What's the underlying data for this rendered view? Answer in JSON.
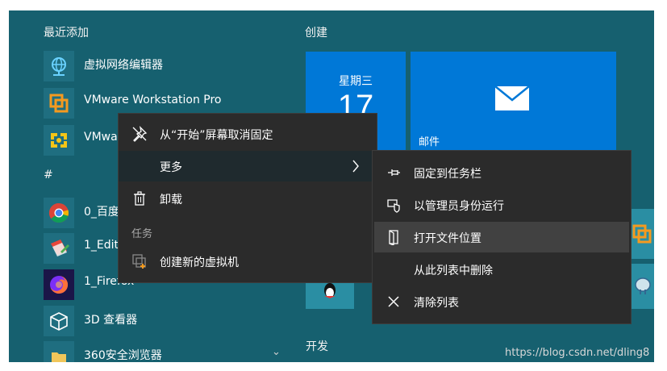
{
  "start_menu": {
    "recent_header": "最近添加",
    "create_header": "创建",
    "dev_header": "开发",
    "hash_header": "#",
    "apps": [
      {
        "label": "虚拟网络编辑器",
        "icon": "globe-network-icon"
      },
      {
        "label": "VMware Workstation Pro",
        "icon": "vmware-icon"
      },
      {
        "label": "VMwa",
        "icon": "vmware-player-icon"
      },
      {
        "label": "0_百度",
        "icon": "chrome-icon"
      },
      {
        "label": "1_Edit",
        "icon": "editor-icon"
      },
      {
        "label": "1_Firefox",
        "icon": "firefox-icon"
      },
      {
        "label": "3D 查看器",
        "icon": "cube-icon"
      },
      {
        "label": "360安全浏览器",
        "icon": "folder-icon"
      }
    ],
    "calendar_tile": {
      "day": "星期三",
      "date": "17"
    },
    "mail_tile": {
      "label": "邮件",
      "icon": "envelope-icon"
    }
  },
  "context_menu": {
    "unpin_label": "从“开始”屏幕取消固定",
    "more_label": "更多",
    "uninstall_label": "卸载",
    "tasks_header": "任务",
    "create_vm_label": "创建新的虚拟机"
  },
  "submenu": {
    "pin_taskbar_label": "固定到任务栏",
    "run_admin_label": "以管理员身份运行",
    "open_location_label": "打开文件位置",
    "remove_list_label": "从此列表中删除",
    "clear_list_label": "清除列表"
  },
  "watermark": "https://blog.csdn.net/dling8",
  "colors": {
    "start_bg": "#16606f",
    "tile_blue": "#0078d7",
    "menu_bg": "#2b2b2b",
    "menu_hover": "#1f2a2e",
    "submenu_hover": "#414141"
  }
}
